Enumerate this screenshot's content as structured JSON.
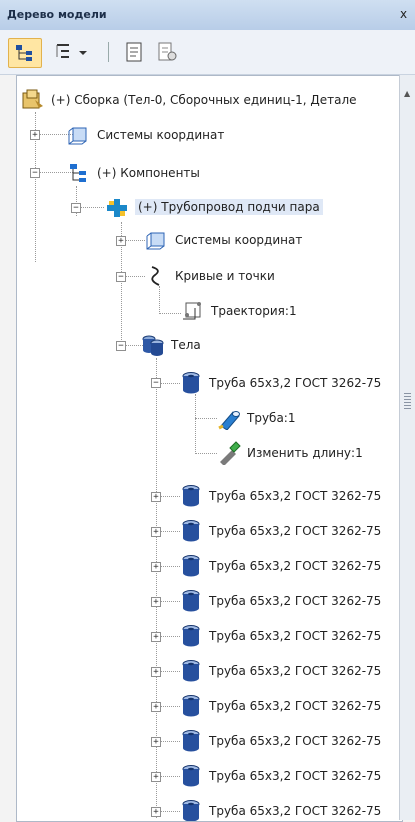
{
  "panel": {
    "title": "Дерево модели",
    "close": "x"
  },
  "tree": {
    "root": "(+) Сборка (Тел-0, Сборочных единиц-1, Детале",
    "coords_top": "Системы координат",
    "components": "(+) Компоненты",
    "pipeline": "(+) Трубопровод подчи пара",
    "coords_sub": "Системы координат",
    "curves": "Кривые и точки",
    "trajectory": "Траектория:1",
    "bodies": "Тела",
    "body_items": [
      "Труба 65х3,2 ГОСТ 3262-75",
      "Труба 65х3,2 ГОСТ 3262-75",
      "Труба 65х3,2 ГОСТ 3262-75",
      "Труба 65х3,2 ГОСТ 3262-75",
      "Труба 65х3,2 ГОСТ 3262-75",
      "Труба 65х3,2 ГОСТ 3262-75",
      "Труба 65х3,2 ГОСТ 3262-75",
      "Труба 65х3,2 ГОСТ 3262-75",
      "Труба 65х3,2 ГОСТ 3262-75",
      "Труба 65х3,2 ГОСТ 3262-75",
      "Труба 65х3,2 ГОСТ 3262-75",
      "Труба 65х3,2 ГОСТ 3262-75"
    ],
    "pipe_op": "Труба:1",
    "length_op": "Изменить длину:1"
  },
  "expander": {
    "plus": "+",
    "minus": "−"
  }
}
